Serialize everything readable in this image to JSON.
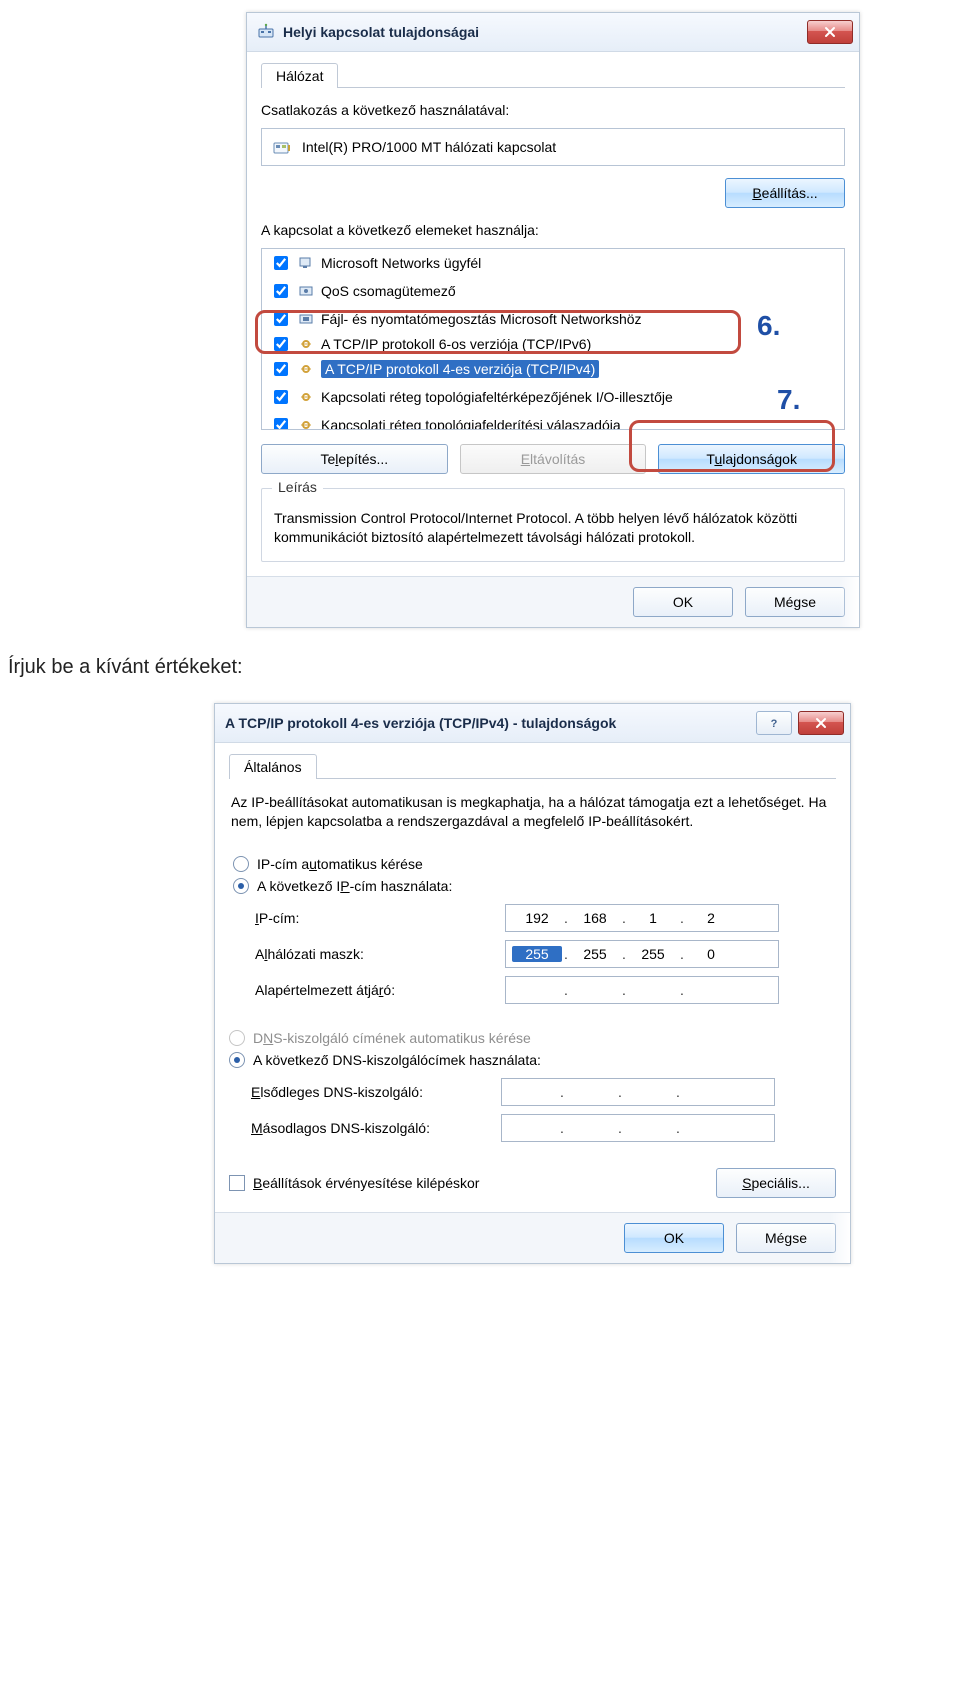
{
  "dialog1": {
    "title": "Helyi kapcsolat tulajdonságai",
    "tab": "Hálózat",
    "connect_label": "Csatlakozás a következő használatával:",
    "adapter": "Intel(R) PRO/1000 MT hálózati kapcsolat",
    "configure_btn": "Beállítás...",
    "uses_label": "A kapcsolat a következő elemeket használja:",
    "items": [
      "Microsoft Networks ügyfél",
      "QoS csomagütemező",
      "Fájl- és nyomtatómegosztás Microsoft Networkshöz",
      "A TCP/IP protokoll 6-os verziója (TCP/IPv6)",
      "A TCP/IP protokoll 4-es verziója (TCP/IPv4)",
      "Kapcsolati réteg topológiafeltérképezőjének I/O-illesztője",
      "Kapcsolati réteg topológiafelderítési válaszadója"
    ],
    "install_btn": "Telepítés...",
    "remove_btn": "Eltávolítás",
    "props_btn": "Tulajdonságok",
    "desc_legend": "Leírás",
    "desc": "Transmission Control Protocol/Internet Protocol. A több helyen lévő hálózatok közötti kommunikációt biztosító alapértelmezett távolsági hálózati protokoll.",
    "ok": "OK",
    "cancel": "Mégse",
    "callout6": "6.",
    "callout7": "7."
  },
  "instruction": "Írjuk be a kívánt értékeket:",
  "dialog2": {
    "title": "A TCP/IP protokoll 4-es verziója (TCP/IPv4) - tulajdonságok",
    "tab": "Általános",
    "intro": "Az IP-beállításokat automatikusan is megkaphatja, ha a hálózat támogatja ezt a lehetőséget. Ha nem, lépjen kapcsolatba a rendszergazdával a megfelelő IP-beállításokért.",
    "radio_auto_ip": "IP-cím automatikus kérése",
    "radio_manual_ip": "A következő IP-cím használata:",
    "ip_label": "IP-cím:",
    "mask_label": "Alhálózati maszk:",
    "gw_label": "Alapértelmezett átjáró:",
    "ip": {
      "o1": "192",
      "o2": "168",
      "o3": "1",
      "o4": "2"
    },
    "mask": {
      "o1": "255",
      "o2": "255",
      "o3": "255",
      "o4": "0"
    },
    "radio_auto_dns": "DNS-kiszolgáló címének automatikus kérése",
    "radio_manual_dns": "A következő DNS-kiszolgálócímek használata:",
    "dns1_label": "Elsődleges DNS-kiszolgáló:",
    "dns2_label": "Másodlagos DNS-kiszolgáló:",
    "validate_label": "Beállítások érvényesítése kilépéskor",
    "advanced_btn": "Speciális...",
    "ok": "OK",
    "cancel": "Mégse"
  }
}
